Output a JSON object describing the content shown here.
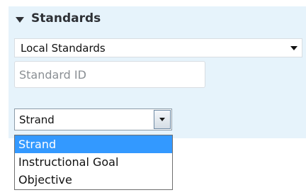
{
  "section": {
    "title": "Standards",
    "caret_icon": "caret-down-icon"
  },
  "local_select": {
    "value": "Local Standards"
  },
  "standard_id": {
    "placeholder": "Standard ID",
    "value": ""
  },
  "strand_select": {
    "value": "Strand",
    "options": [
      "Strand",
      "Instructional Goal",
      "Objective"
    ],
    "selected_index": 0
  },
  "colors": {
    "panel_bg": "#e6f3fb",
    "selected_option": "#3399ff"
  }
}
